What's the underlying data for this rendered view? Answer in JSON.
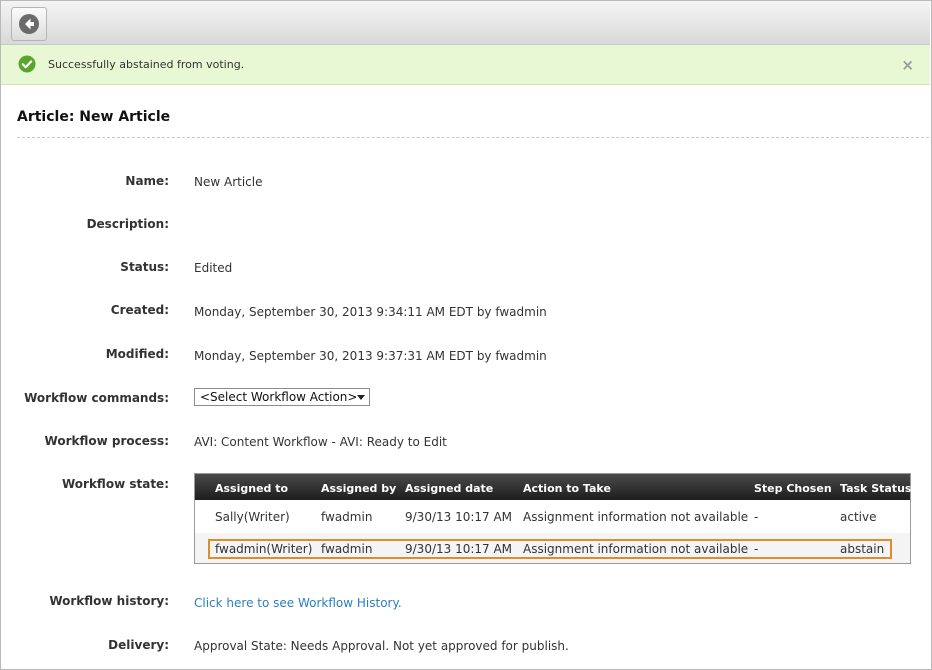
{
  "notice": {
    "message": "Successfully abstained from voting.",
    "close": "×"
  },
  "article": {
    "title": "Article: New Article"
  },
  "fields": {
    "name": {
      "label": "Name:",
      "value": "New Article"
    },
    "description": {
      "label": "Description:",
      "value": ""
    },
    "status": {
      "label": "Status:",
      "value": "Edited"
    },
    "created": {
      "label": "Created:",
      "value": "Monday, September 30, 2013 9:34:11 AM EDT by fwadmin"
    },
    "modified": {
      "label": "Modified:",
      "value": "Monday, September 30, 2013 9:37:31 AM EDT by fwadmin"
    },
    "workflow_commands": {
      "label": "Workflow commands:",
      "selected": "<Select Workflow Action>"
    },
    "workflow_process": {
      "label": "Workflow process:",
      "value": "AVI: Content Workflow - AVI: Ready to Edit"
    },
    "workflow_state": {
      "label": "Workflow state:"
    },
    "workflow_history": {
      "label": "Workflow history:",
      "link": "Click here to see Workflow History."
    },
    "delivery": {
      "label": "Delivery:",
      "value": "Approval State: Needs Approval. Not yet approved for publish."
    }
  },
  "workflow_table": {
    "headers": [
      "Assigned to",
      "Assigned by",
      "Assigned date",
      "Action to Take",
      "Step Chosen",
      "Task Status"
    ],
    "rows": [
      [
        "Sally(Writer)",
        "fwadmin",
        "9/30/13 10:17 AM",
        "Assignment information not available",
        "-",
        "active"
      ],
      [
        "fwadmin(Writer)",
        "fwadmin",
        "9/30/13 10:17 AM",
        "Assignment information not available",
        "-",
        "abstain"
      ]
    ]
  },
  "colors": {
    "notice_bg": "#e8f8d4",
    "success": "#5aa52e",
    "highlight": "#e08b2c",
    "link": "#2a7fc0",
    "header_bg": "#2b2b2b"
  },
  "icons": {
    "back": "back-arrow-icon",
    "success": "check-circle-icon",
    "close": "close-icon",
    "dropdown": "chevron-down-icon"
  }
}
